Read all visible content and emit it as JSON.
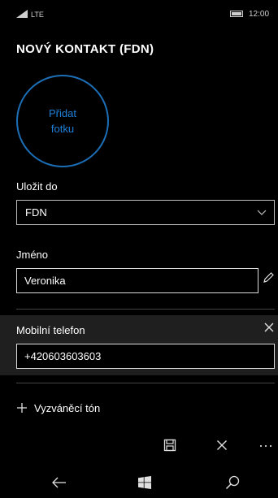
{
  "status_bar": {
    "network": "LTE",
    "time": "12:00"
  },
  "page": {
    "title": "NOVÝ KONTAKT (FDN)"
  },
  "photo": {
    "label": "Přidat fotku"
  },
  "save_to": {
    "label": "Uložit do",
    "value": "FDN"
  },
  "name": {
    "label": "Jméno",
    "value": "Veronika"
  },
  "mobile": {
    "label": "Mobilní telefon",
    "value": "+420603603603"
  },
  "ringtone": {
    "label": "Vyzváněcí tón"
  },
  "icons": {
    "signal": "signal-icon",
    "battery": "battery-icon",
    "chevron": "chevron-down-icon",
    "pencil": "pencil-icon",
    "close": "close-icon",
    "plus": "plus-icon",
    "save": "save-icon",
    "cancel": "cancel-icon",
    "more": "more-icon",
    "back": "back-icon",
    "windows": "windows-icon",
    "search": "search-icon"
  },
  "colors": {
    "accent": "#1E80D8",
    "background": "#000000",
    "field_border": "#DCDCDC",
    "section_bg": "#1F1F1F"
  }
}
